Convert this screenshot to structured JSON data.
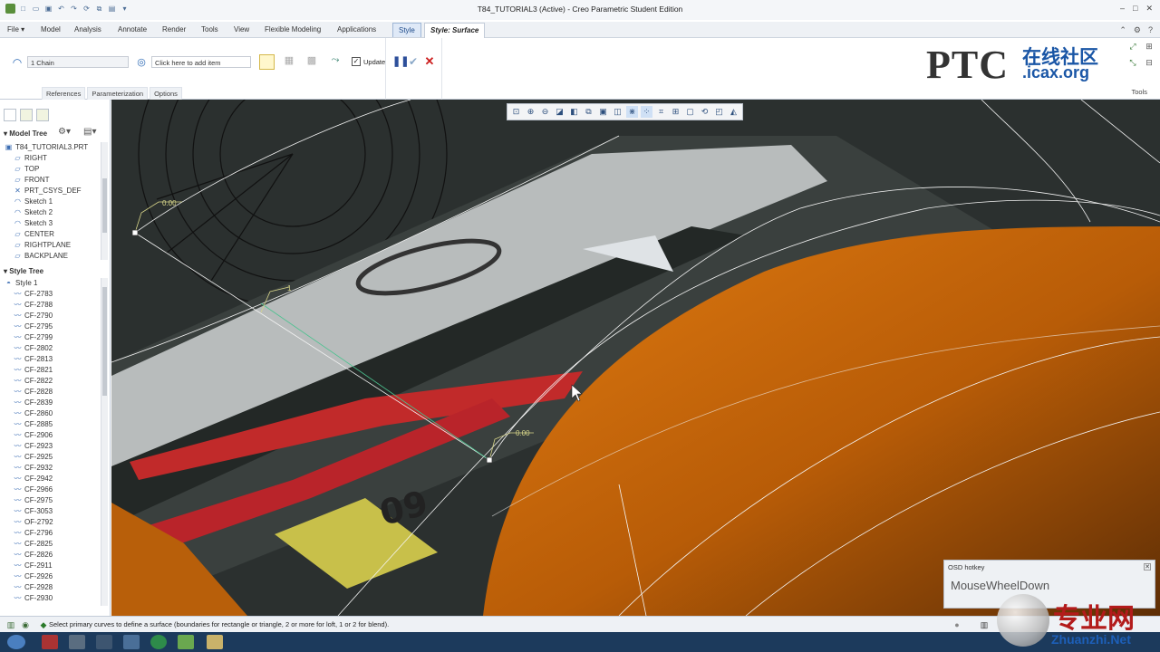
{
  "window": {
    "title": "T84_TUTORIAL3 (Active) - Creo Parametric Student Edition"
  },
  "tabs": [
    {
      "label": "File ▾"
    },
    {
      "label": "Model"
    },
    {
      "label": "Analysis"
    },
    {
      "label": "Annotate"
    },
    {
      "label": "Render"
    },
    {
      "label": "Tools"
    },
    {
      "label": "View"
    },
    {
      "label": "Flexible Modeling"
    },
    {
      "label": "Applications"
    },
    {
      "label": "Style"
    },
    {
      "label": "Style: Surface"
    }
  ],
  "ribbon": {
    "chain_collector": "1 Chain",
    "add_item_collector": "Click here to add item",
    "update_label": "Update",
    "update_checked": true,
    "subtabs": [
      "References",
      "Parameterization",
      "Options"
    ],
    "tools_label": "Tools"
  },
  "logo": {
    "brand": "PTC",
    "cn": "在线社区",
    "url": ".icax.org"
  },
  "model_tree": {
    "header": "Model Tree",
    "root": "T84_TUTORIAL3.PRT",
    "items": [
      {
        "label": "RIGHT",
        "icon": "datum-plane-icon",
        "glyph": "▱"
      },
      {
        "label": "TOP",
        "icon": "datum-plane-icon",
        "glyph": "▱"
      },
      {
        "label": "FRONT",
        "icon": "datum-plane-icon",
        "glyph": "▱"
      },
      {
        "label": "PRT_CSYS_DEF",
        "icon": "csys-icon",
        "glyph": "✕"
      },
      {
        "label": "Sketch 1",
        "icon": "sketch-icon",
        "glyph": "◠"
      },
      {
        "label": "Sketch 2",
        "icon": "sketch-icon",
        "glyph": "◠"
      },
      {
        "label": "Sketch 3",
        "icon": "sketch-icon",
        "glyph": "◠"
      },
      {
        "label": "CENTER",
        "icon": "datum-plane-icon",
        "glyph": "▱"
      },
      {
        "label": "RIGHTPLANE",
        "icon": "datum-plane-icon",
        "glyph": "▱"
      },
      {
        "label": "BACKPLANE",
        "icon": "datum-plane-icon",
        "glyph": "▱"
      }
    ]
  },
  "style_tree": {
    "header": "Style Tree",
    "root": "Style 1",
    "items": [
      "CF-2783",
      "CF-2788",
      "CF-2790",
      "CF-2795",
      "CF-2799",
      "CF-2802",
      "CF-2813",
      "CF-2821",
      "CF-2822",
      "CF-2828",
      "CF-2839",
      "CF-2860",
      "CF-2885",
      "CF-2906",
      "CF-2923",
      "CF-2925",
      "CF-2932",
      "CF-2942",
      "CF-2966",
      "CF-2975",
      "CF-3053",
      "OF-2792",
      "CF-2796",
      "CF-2825",
      "CF-2826",
      "CF-2911",
      "CF-2926",
      "CF-2928",
      "CF-2930"
    ]
  },
  "viewport": {
    "dim_labels": [
      "0.00",
      "1",
      "0.00"
    ],
    "osd_header": "OSD hotkey",
    "osd_value": "MouseWheelDown",
    "surface_color": "#c8680a"
  },
  "status": {
    "message": "Select primary curves to define a surface (boundaries for rectangle or triangle, 2 or more for loft, 1 or 2 for blend)."
  },
  "watermark": {
    "cn": "专业网",
    "url": "Zhuanzhi.Net"
  }
}
